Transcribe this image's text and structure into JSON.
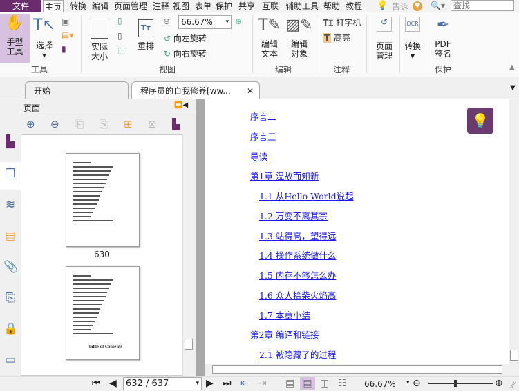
{
  "menubar": {
    "file": "文件",
    "items": [
      "主页",
      "转换",
      "编辑",
      "页面管理",
      "注释",
      "视图",
      "表单",
      "保护",
      "共享",
      "互联",
      "辅助工具",
      "帮助",
      "教程"
    ],
    "tell": "告诉",
    "search_placeholder": "查找"
  },
  "ribbon": {
    "hand": "手型\n工具",
    "select": "选择",
    "actual": "实际\n大小",
    "reflow": "重排",
    "zoom": "66.67%",
    "rotate_left": "向左旋转",
    "rotate_right": "向右旋转",
    "edit_text": "编辑\n文本",
    "edit_object": "编辑\n对象",
    "typewriter": "打字机",
    "highlight": "高亮",
    "page_manage": "页面\n管理",
    "convert": "转换",
    "pdf_sign": "PDF\n签名",
    "groups": {
      "tools": "工具",
      "view": "视图",
      "edit": "编辑",
      "comment": "注释",
      "protect": "保护"
    }
  },
  "tabs": [
    {
      "label": "开始"
    },
    {
      "label": "程序员的自我修养[ww..."
    }
  ],
  "panel": {
    "title": "页面",
    "thumb_label": "630",
    "thumb2_title": "Table of Contents"
  },
  "toc": [
    {
      "label": "序言二",
      "level": 1
    },
    {
      "label": "序言三",
      "level": 1
    },
    {
      "label": "导读",
      "level": 1
    },
    {
      "label": "第1章 温故而知新",
      "level": 1
    },
    {
      "label": "1.1 从Hello World说起",
      "level": 2
    },
    {
      "label": "1.2 万变不离其宗",
      "level": 2
    },
    {
      "label": "1.3 站得高，望得远",
      "level": 2
    },
    {
      "label": "1.4 操作系统做什么",
      "level": 2
    },
    {
      "label": "1.5 内存不够怎么办",
      "level": 2
    },
    {
      "label": "1.6 众人拾柴火焰高",
      "level": 2
    },
    {
      "label": "1.7 本章小结",
      "level": 2
    },
    {
      "label": "第2章 编译和链接",
      "level": 1
    },
    {
      "label": "2.1 被隐藏了的过程",
      "level": 2
    }
  ],
  "status": {
    "page": "632 / 637",
    "zoom": "66.67%",
    "zoom_slider_percent": 40
  },
  "colors": {
    "accent": "#6b2c6e",
    "link": "#1a1aee",
    "hint_bg": "#6b3a6e"
  }
}
